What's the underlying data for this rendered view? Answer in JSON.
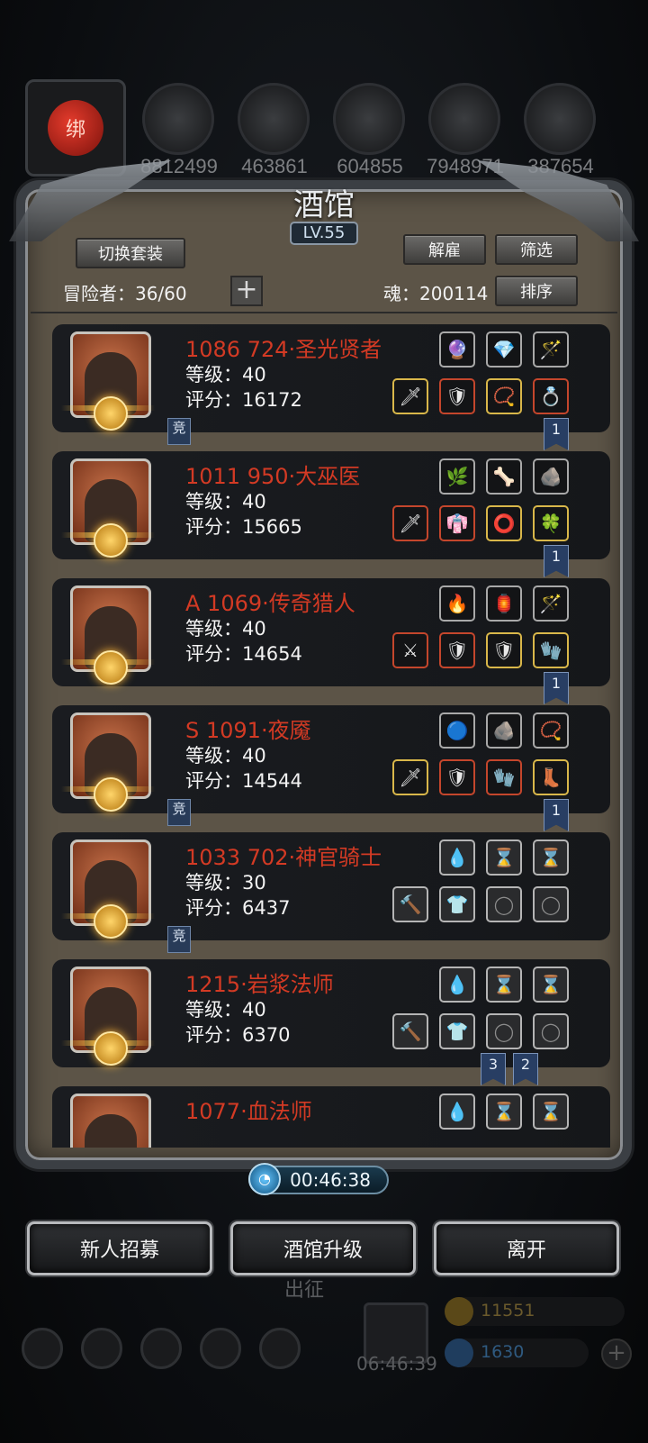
{
  "top_resources": {
    "avatar_seal": "绑",
    "values": [
      "8812499",
      "463861",
      "604855",
      "7948971",
      "387654"
    ]
  },
  "tavern": {
    "title": "酒馆",
    "level": "LV.55",
    "switch_set_label": "切换套装",
    "dismiss_label": "解雇",
    "filter_label": "筛选",
    "sort_label": "排序",
    "adventurers": "冒险者：36/60",
    "plus": "+",
    "souls": "魂：200114"
  },
  "heroes": [
    {
      "name": "1086 724·圣光贤者",
      "level": "等级：40",
      "score": "评分：16172",
      "jing": "竞",
      "ribbons": [
        "1"
      ]
    },
    {
      "name": "1011 950·大巫医",
      "level": "等级：40",
      "score": "评分：15665",
      "jing": "",
      "ribbons": [
        "1"
      ]
    },
    {
      "name": "A 1069·传奇猎人",
      "level": "等级：40",
      "score": "评分：14654",
      "jing": "",
      "ribbons": [
        "1"
      ]
    },
    {
      "name": "S 1091·夜魇",
      "level": "等级：40",
      "score": "评分：14544",
      "jing": "竞",
      "ribbons": [
        "1"
      ]
    },
    {
      "name": "1033 702·神官骑士",
      "level": "等级：30",
      "score": "评分：6437",
      "jing": "竞",
      "ribbons": []
    },
    {
      "name": "1215·岩浆法师",
      "level": "等级：40",
      "score": "评分：6370",
      "jing": "",
      "ribbons": [
        "3",
        "2"
      ]
    },
    {
      "name": "1077·血法师",
      "level": "",
      "score": "",
      "jing": "",
      "ribbons": []
    }
  ],
  "timer": {
    "value": "00:46:38",
    "icon": "clock-icon"
  },
  "buttons": {
    "recruit": "新人招募",
    "upgrade": "酒馆升级",
    "leave": "离开"
  },
  "background_hud": {
    "expedition": "出征",
    "gift_timer": "06:46:39",
    "gold": "11551",
    "gems": "1630"
  },
  "colors": {
    "hero_name": "#d33a24",
    "panel_bg": "#5c5447",
    "card_bg": "#1a1c20",
    "gold_border": "#d9b74a"
  }
}
